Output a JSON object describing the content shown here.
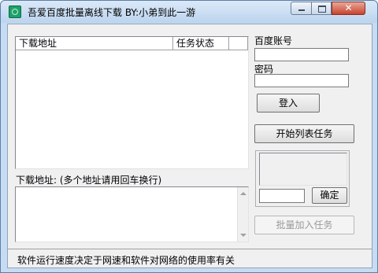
{
  "window": {
    "title": "吾爱百度批量离线下载  BY:小弟到此一游",
    "close_glyph": "✕"
  },
  "task_list": {
    "columns": [
      "下载地址",
      "任务状态",
      ""
    ],
    "rows": []
  },
  "login": {
    "account_label": "百度账号",
    "account_value": "",
    "password_label": "密码",
    "password_value": "",
    "login_button": "登入"
  },
  "start_tasks_button": "开始列表任务",
  "captcha": {
    "input_value": "",
    "confirm_button": "确定"
  },
  "download": {
    "label": "下载地址:   (多个地址请用回车换行)",
    "textarea_value": ""
  },
  "batch_add_button": "批量加入任务",
  "status_text": "软件运行速度决定于网速和软件对网络的使用率有关"
}
